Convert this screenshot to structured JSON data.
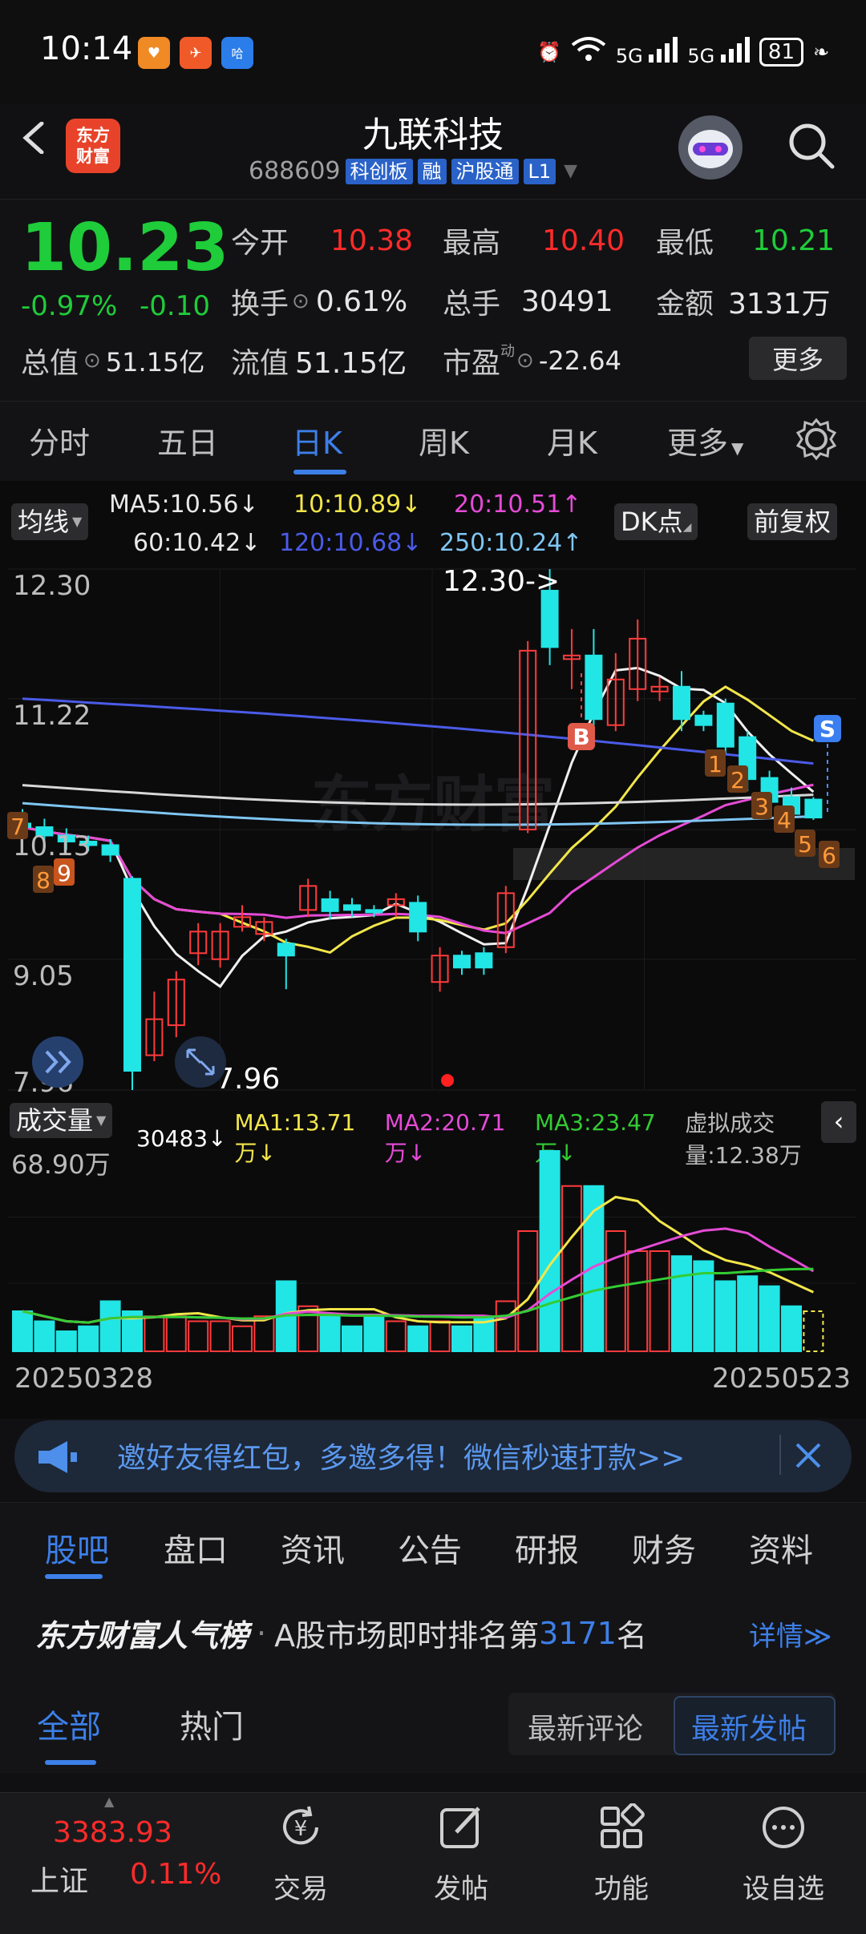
{
  "status_bar": {
    "time": "10:14",
    "battery": "81",
    "network": [
      "5G",
      "5G"
    ]
  },
  "header": {
    "title": "九联科技",
    "code": "688609",
    "tags": [
      "科创板",
      "融",
      "沪股通",
      "L1"
    ],
    "logo_text": [
      "东方",
      "财富"
    ]
  },
  "quote": {
    "price": "10.23",
    "change_pct": "-0.97%",
    "change": "-0.10",
    "total_value_label": "总值",
    "total_value": "51.15亿",
    "open_label": "今开",
    "open": "10.38",
    "high_label": "最高",
    "high": "10.40",
    "low_label": "最低",
    "low": "10.21",
    "turnover_label": "换手",
    "turnover": "0.61%",
    "volume_label": "总手",
    "volume": "30491",
    "amount_label": "金额",
    "amount": "3131万",
    "float_label": "流值",
    "float_value": "51.15亿",
    "pe_label": "市盈",
    "pe_sup": "动",
    "pe": "-22.64",
    "more": "更多"
  },
  "period_tabs": [
    "分时",
    "五日",
    "日K",
    "周K",
    "月K",
    "更多"
  ],
  "ma_bar": {
    "selector": "均线",
    "ma5": "MA5:10.56",
    "ma10": "10:10.89",
    "ma20": "20:10.51",
    "ma60": "60:10.42",
    "ma120": "120:10.68",
    "ma250": "250:10.24",
    "dk": "DK点",
    "adjust": "前复权"
  },
  "chart_data": {
    "type": "candlestick",
    "price_axis": [
      "12.30",
      "11.22",
      "10.13",
      "9.05",
      "7.96"
    ],
    "ylim": [
      7.96,
      12.3
    ],
    "annotations": [
      "12.30->",
      "<-7.96"
    ],
    "watermark": "东方财富",
    "signals": [
      "B",
      "S"
    ],
    "markers": [
      "7",
      "8",
      "9",
      "1",
      "2",
      "3",
      "4",
      "5",
      "6"
    ],
    "candles": [
      {
        "o": 10.18,
        "c": 10.15,
        "h": 10.3,
        "l": 10.0
      },
      {
        "o": 10.15,
        "c": 10.08,
        "h": 10.22,
        "l": 10.02
      },
      {
        "o": 10.08,
        "c": 10.03,
        "h": 10.14,
        "l": 9.96
      },
      {
        "o": 10.03,
        "c": 10.0,
        "h": 10.08,
        "l": 9.95
      },
      {
        "o": 10.0,
        "c": 9.92,
        "h": 10.05,
        "l": 9.86
      },
      {
        "o": 9.72,
        "c": 8.12,
        "h": 9.74,
        "l": 7.96
      },
      {
        "o": 8.25,
        "c": 8.55,
        "h": 8.78,
        "l": 8.2
      },
      {
        "o": 8.5,
        "c": 8.88,
        "h": 8.95,
        "l": 8.4
      },
      {
        "o": 9.1,
        "c": 9.28,
        "h": 9.35,
        "l": 9.0
      },
      {
        "o": 9.05,
        "c": 9.28,
        "h": 9.35,
        "l": 8.98
      },
      {
        "o": 9.32,
        "c": 9.4,
        "h": 9.5,
        "l": 9.28
      },
      {
        "o": 9.26,
        "c": 9.36,
        "h": 9.4,
        "l": 9.2
      },
      {
        "o": 9.18,
        "c": 9.08,
        "h": 9.22,
        "l": 8.8
      },
      {
        "o": 9.46,
        "c": 9.66,
        "h": 9.72,
        "l": 9.4
      },
      {
        "o": 9.55,
        "c": 9.45,
        "h": 9.62,
        "l": 9.38
      },
      {
        "o": 9.5,
        "c": 9.46,
        "h": 9.56,
        "l": 9.4
      },
      {
        "o": 9.46,
        "c": 9.44,
        "h": 9.5,
        "l": 9.4
      },
      {
        "o": 9.5,
        "c": 9.55,
        "h": 9.6,
        "l": 9.4
      },
      {
        "o": 9.52,
        "c": 9.28,
        "h": 9.58,
        "l": 9.2
      },
      {
        "o": 8.86,
        "c": 9.08,
        "h": 9.15,
        "l": 8.78
      },
      {
        "o": 9.08,
        "c": 8.98,
        "h": 9.12,
        "l": 8.92
      },
      {
        "o": 9.1,
        "c": 8.98,
        "h": 9.15,
        "l": 8.92
      },
      {
        "o": 9.15,
        "c": 9.6,
        "h": 9.66,
        "l": 9.1
      },
      {
        "o": 10.13,
        "c": 11.62,
        "h": 11.7,
        "l": 10.1
      },
      {
        "o": 12.12,
        "c": 11.65,
        "h": 12.3,
        "l": 11.5
      },
      {
        "o": 11.55,
        "c": 11.58,
        "h": 11.8,
        "l": 11.3
      },
      {
        "o": 11.58,
        "c": 11.05,
        "h": 11.8,
        "l": 10.95
      },
      {
        "o": 11.0,
        "c": 11.38,
        "h": 11.6,
        "l": 10.95
      },
      {
        "o": 11.3,
        "c": 11.72,
        "h": 11.88,
        "l": 11.2
      },
      {
        "o": 11.28,
        "c": 11.32,
        "h": 11.4,
        "l": 11.2
      },
      {
        "o": 11.32,
        "c": 11.05,
        "h": 11.45,
        "l": 10.95
      },
      {
        "o": 11.08,
        "c": 11.0,
        "h": 11.12,
        "l": 10.95
      },
      {
        "o": 11.18,
        "c": 10.82,
        "h": 11.22,
        "l": 10.76
      },
      {
        "o": 10.9,
        "c": 10.55,
        "h": 10.95,
        "l": 10.45
      },
      {
        "o": 10.56,
        "c": 10.36,
        "h": 10.62,
        "l": 10.3
      },
      {
        "o": 10.4,
        "c": 10.26,
        "h": 10.48,
        "l": 10.2
      },
      {
        "o": 10.38,
        "c": 10.23,
        "h": 10.4,
        "l": 10.21
      }
    ]
  },
  "volume_bar": {
    "selector": "成交量",
    "vol": "30483",
    "ma1": "MA1:13.71万",
    "ma2": "MA2:20.71万",
    "ma3": "MA3:23.47万",
    "virtual": "虚拟成交量:12.38万",
    "axis_max": "68.90万",
    "date_start": "20250328",
    "date_end": "20250523",
    "volumes": [
      8,
      6,
      4,
      5,
      10,
      8,
      7,
      7,
      6,
      6,
      5,
      7,
      14,
      9,
      7,
      5,
      7,
      6,
      5,
      6,
      5,
      7,
      10,
      24,
      40,
      33,
      33,
      24,
      20,
      20,
      19,
      18,
      14,
      15,
      13,
      9,
      8
    ]
  },
  "promo": {
    "text": "邀好友得红包，多邀多得！微信秒速打款>>"
  },
  "lower_tabs": [
    "股吧",
    "盘口",
    "资讯",
    "公告",
    "研报",
    "财务",
    "资料"
  ],
  "rank": {
    "brand": "东方财富人气榜",
    "text": "A股市场即时排名第",
    "rank_no": "3171",
    "suffix": "名",
    "detail": "详情"
  },
  "subtabs": {
    "all": "全部",
    "hot": "热门",
    "latest_comment": "最新评论",
    "latest_post": "最新发帖"
  },
  "bottom": {
    "index_value": "3383.93",
    "index_name": "上证",
    "index_change": "0.11%",
    "nav": [
      "交易",
      "发帖",
      "功能",
      "设自选"
    ]
  }
}
